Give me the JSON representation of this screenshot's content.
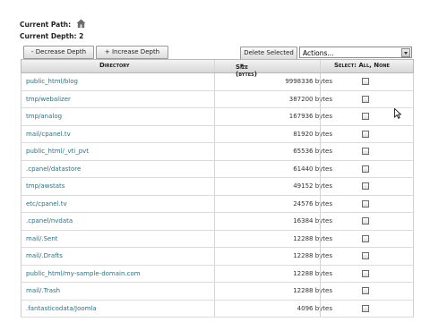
{
  "path": {
    "label": "Current Path:",
    "icon": "home-icon"
  },
  "depth": {
    "label": "Current Depth:",
    "value": "2"
  },
  "toolbar": {
    "decrease": "- Decrease Depth",
    "increase": "+ Increase Depth",
    "delete": "Delete Selected",
    "actions": "Actions..."
  },
  "table": {
    "headers": {
      "directory": "Directory",
      "size": "Size (bytes)",
      "sort_indicator": "▼",
      "select": "Select: All, None"
    },
    "rows": [
      {
        "dir": "public_html/blog",
        "size": "9998336 bytes"
      },
      {
        "dir": "tmp/webalizer",
        "size": "387200 bytes"
      },
      {
        "dir": "tmp/analog",
        "size": "167936 bytes"
      },
      {
        "dir": "mail/cpanel.tv",
        "size": "81920 bytes"
      },
      {
        "dir": "public_html/_vti_pvt",
        "size": "65536 bytes"
      },
      {
        "dir": ".cpanel/datastore",
        "size": "61440 bytes"
      },
      {
        "dir": "tmp/awstats",
        "size": "49152 bytes"
      },
      {
        "dir": "etc/cpanel.tv",
        "size": "24576 bytes"
      },
      {
        "dir": ".cpanel/nvdata",
        "size": "16384 bytes"
      },
      {
        "dir": "mail/.Sent",
        "size": "12288 bytes"
      },
      {
        "dir": "mail/.Drafts",
        "size": "12288 bytes"
      },
      {
        "dir": "public_html/my-sample-domain.com",
        "size": "12288 bytes"
      },
      {
        "dir": "mail/.Trash",
        "size": "12288 bytes"
      },
      {
        "dir": ".fantasticodata/Joomla",
        "size": "4096 bytes"
      }
    ]
  }
}
